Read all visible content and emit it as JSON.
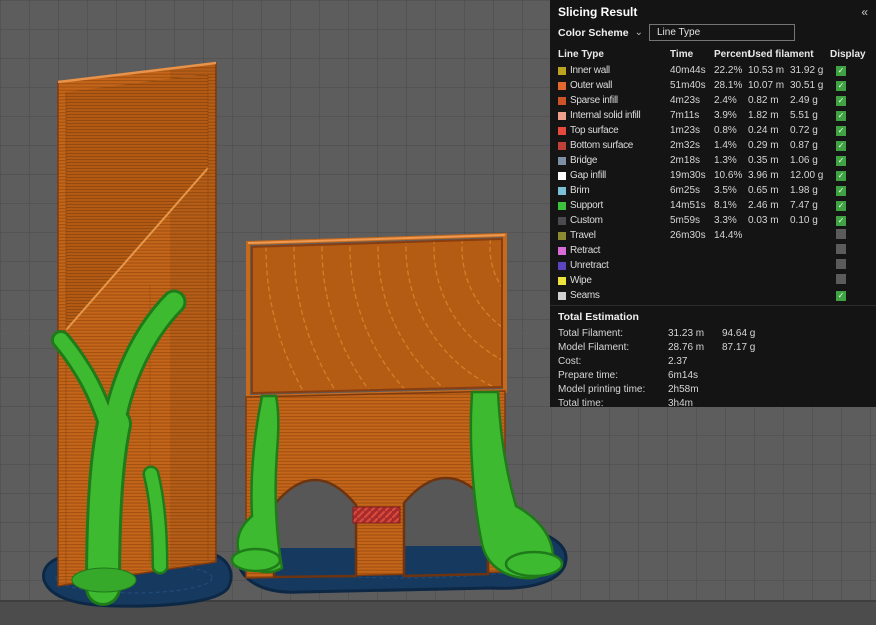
{
  "panel": {
    "title": "Slicing Result",
    "collapse_icon": "«",
    "color_scheme_label": "Color Scheme",
    "chevron_icon": "⌄",
    "color_scheme_value": "Line Type",
    "table": {
      "headers": [
        "Line Type",
        "Time",
        "Percent",
        "Used filament",
        "Display"
      ],
      "rows": [
        {
          "label": "Inner wall",
          "color": "#BEA321",
          "time": "40m44s",
          "percent": "22.2%",
          "filament_m": "10.53 m",
          "filament_g": "31.92 g",
          "display": "checked"
        },
        {
          "label": "Outer wall",
          "color": "#E2692B",
          "time": "51m40s",
          "percent": "28.1%",
          "filament_m": "10.07 m",
          "filament_g": "30.51 g",
          "display": "checked"
        },
        {
          "label": "Sparse infill",
          "color": "#CB5327",
          "time": "4m23s",
          "percent": "2.4%",
          "filament_m": "0.82 m",
          "filament_g": "2.49 g",
          "display": "checked"
        },
        {
          "label": "Internal solid infill",
          "color": "#EE9E8C",
          "time": "7m11s",
          "percent": "3.9%",
          "filament_m": "1.82 m",
          "filament_g": "5.51 g",
          "display": "checked"
        },
        {
          "label": "Top surface",
          "color": "#E64A3F",
          "time": "1m23s",
          "percent": "0.8%",
          "filament_m": "0.24 m",
          "filament_g": "0.72 g",
          "display": "checked"
        },
        {
          "label": "Bottom surface",
          "color": "#C04036",
          "time": "2m32s",
          "percent": "1.4%",
          "filament_m": "0.29 m",
          "filament_g": "0.87 g",
          "display": "checked"
        },
        {
          "label": "Bridge",
          "color": "#7C8FA5",
          "time": "2m18s",
          "percent": "1.3%",
          "filament_m": "0.35 m",
          "filament_g": "1.06 g",
          "display": "checked"
        },
        {
          "label": "Gap infill",
          "color": "#FFFFFF",
          "time": "19m30s",
          "percent": "10.6%",
          "filament_m": "3.96 m",
          "filament_g": "12.00 g",
          "display": "checked"
        },
        {
          "label": "Brim",
          "color": "#7CC0D8",
          "time": "6m25s",
          "percent": "3.5%",
          "filament_m": "0.65 m",
          "filament_g": "1.98 g",
          "display": "checked"
        },
        {
          "label": "Support",
          "color": "#3CC23C",
          "time": "14m51s",
          "percent": "8.1%",
          "filament_m": "2.46 m",
          "filament_g": "7.47 g",
          "display": "checked"
        },
        {
          "label": "Custom",
          "color": "#4A4A50",
          "time": "5m59s",
          "percent": "3.3%",
          "filament_m": "0.03 m",
          "filament_g": "0.10 g",
          "display": "checked"
        },
        {
          "label": "Travel",
          "color": "#8A8A32",
          "time": "26m30s",
          "percent": "14.4%",
          "filament_m": "",
          "filament_g": "",
          "display": "unchecked"
        },
        {
          "label": "Retract",
          "color": "#D86BD8",
          "time": "",
          "percent": "",
          "filament_m": "",
          "filament_g": "",
          "display": "unchecked"
        },
        {
          "label": "Unretract",
          "color": "#5E44C0",
          "time": "",
          "percent": "",
          "filament_m": "",
          "filament_g": "",
          "display": "unchecked"
        },
        {
          "label": "Wipe",
          "color": "#EDE33E",
          "time": "",
          "percent": "",
          "filament_m": "",
          "filament_g": "",
          "display": "unchecked"
        },
        {
          "label": "Seams",
          "color": "#D0D0D0",
          "time": "",
          "percent": "",
          "filament_m": "",
          "filament_g": "",
          "display": "checked"
        }
      ]
    },
    "total_estimation": {
      "title": "Total Estimation",
      "rows": [
        {
          "label": "Total Filament:",
          "value_1": "31.23 m",
          "value_2": "94.64 g"
        },
        {
          "label": "Model Filament:",
          "value_1": "28.76 m",
          "value_2": "87.17 g"
        },
        {
          "label": "Cost:",
          "value_1": "2.37",
          "value_2": ""
        },
        {
          "label": "Prepare time:",
          "value_1": "6m14s",
          "value_2": ""
        },
        {
          "label": "Model printing time:",
          "value_1": "2h58m",
          "value_2": ""
        },
        {
          "label": "Total time:",
          "value_1": "3h4m",
          "value_2": ""
        }
      ]
    }
  },
  "viewport": {
    "colors": {
      "background": "#5d5d5d",
      "model_walls": "#C4651A",
      "support": "#3DBA2F",
      "brim": "#16395F",
      "bridge_highlight": "#A62B2B",
      "plate_edge": "#4c4c4c"
    },
    "models": [
      "tall-tower-with-tree-support",
      "box-with-arches-and-supports"
    ]
  }
}
